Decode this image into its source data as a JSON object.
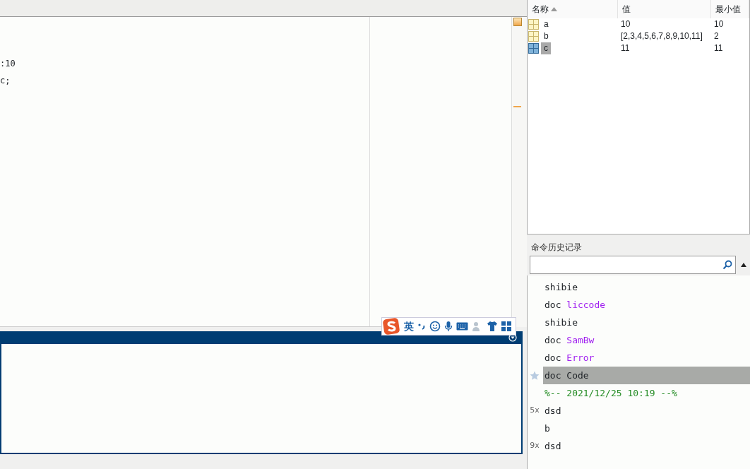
{
  "editor": {
    "lines": [
      {
        "text": ":10"
      },
      {
        "text": "c;"
      }
    ]
  },
  "workspace": {
    "columns": [
      {
        "label": "名称",
        "sorted": true
      },
      {
        "label": "值",
        "sorted": false
      },
      {
        "label": "最小值",
        "sorted": false
      }
    ],
    "rows": [
      {
        "name": "a",
        "value": "10",
        "min": "10",
        "kind": "scalar",
        "selected": false
      },
      {
        "name": "b",
        "value": "[2,3,4,5,6,7,8,9,10,11]",
        "min": "2",
        "kind": "scalar",
        "selected": false
      },
      {
        "name": "c",
        "value": "11",
        "min": "11",
        "kind": "matrix",
        "selected": true
      }
    ]
  },
  "history": {
    "title": "命令历史记录",
    "items": [
      {
        "kind": "command",
        "text": "shibie",
        "selected": false
      },
      {
        "kind": "doc",
        "text": "doc",
        "arg": "liccode",
        "selected": false
      },
      {
        "kind": "command",
        "text": "shibie",
        "selected": false
      },
      {
        "kind": "doc",
        "text": "doc",
        "arg": "SamBw",
        "selected": false
      },
      {
        "kind": "doc",
        "text": "doc",
        "arg": "Error",
        "selected": false
      },
      {
        "kind": "command",
        "text": "doc Code",
        "selected": true
      },
      {
        "kind": "comment",
        "text": "%-- 2021/12/25 10:19 --%",
        "selected": false
      },
      {
        "kind": "command",
        "count": "5x",
        "text": "dsd",
        "selected": false
      },
      {
        "kind": "command",
        "text": "b",
        "selected": false
      },
      {
        "kind": "command",
        "count": "9x",
        "text": "dsd",
        "selected": false
      }
    ]
  },
  "ime_toolbar": {
    "label": "英"
  }
}
